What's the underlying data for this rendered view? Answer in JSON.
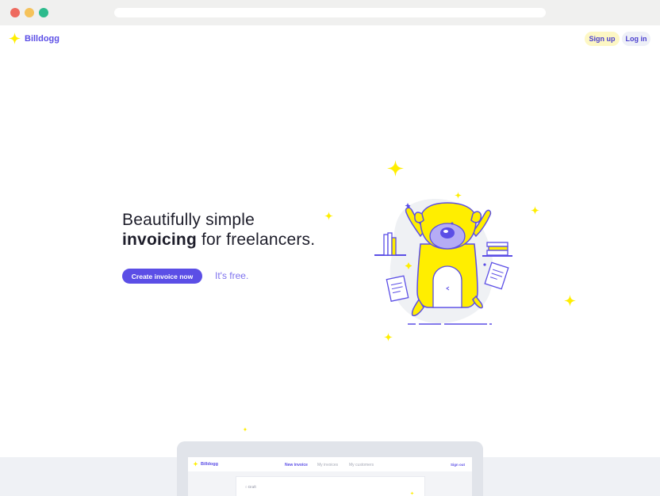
{
  "header": {
    "brand": "Billdogg",
    "signup_label": "Sign up",
    "login_label": "Log in"
  },
  "hero": {
    "line1": "Beautifully simple",
    "line2_bold": "invoicing",
    "line2_rest": " for freelancers.",
    "cta_label": "Create invoice now",
    "free_text": "It's free."
  },
  "preview": {
    "brand": "Billdogg",
    "nav": [
      "New invoice",
      "My invoices",
      "My customers"
    ],
    "signout": "Sign out",
    "draft_label": "Draft"
  },
  "colors": {
    "accent": "#5b4ee6",
    "yellow": "#ffee00",
    "signup_bg": "#fdf7c4",
    "login_bg": "#eef0f7"
  }
}
